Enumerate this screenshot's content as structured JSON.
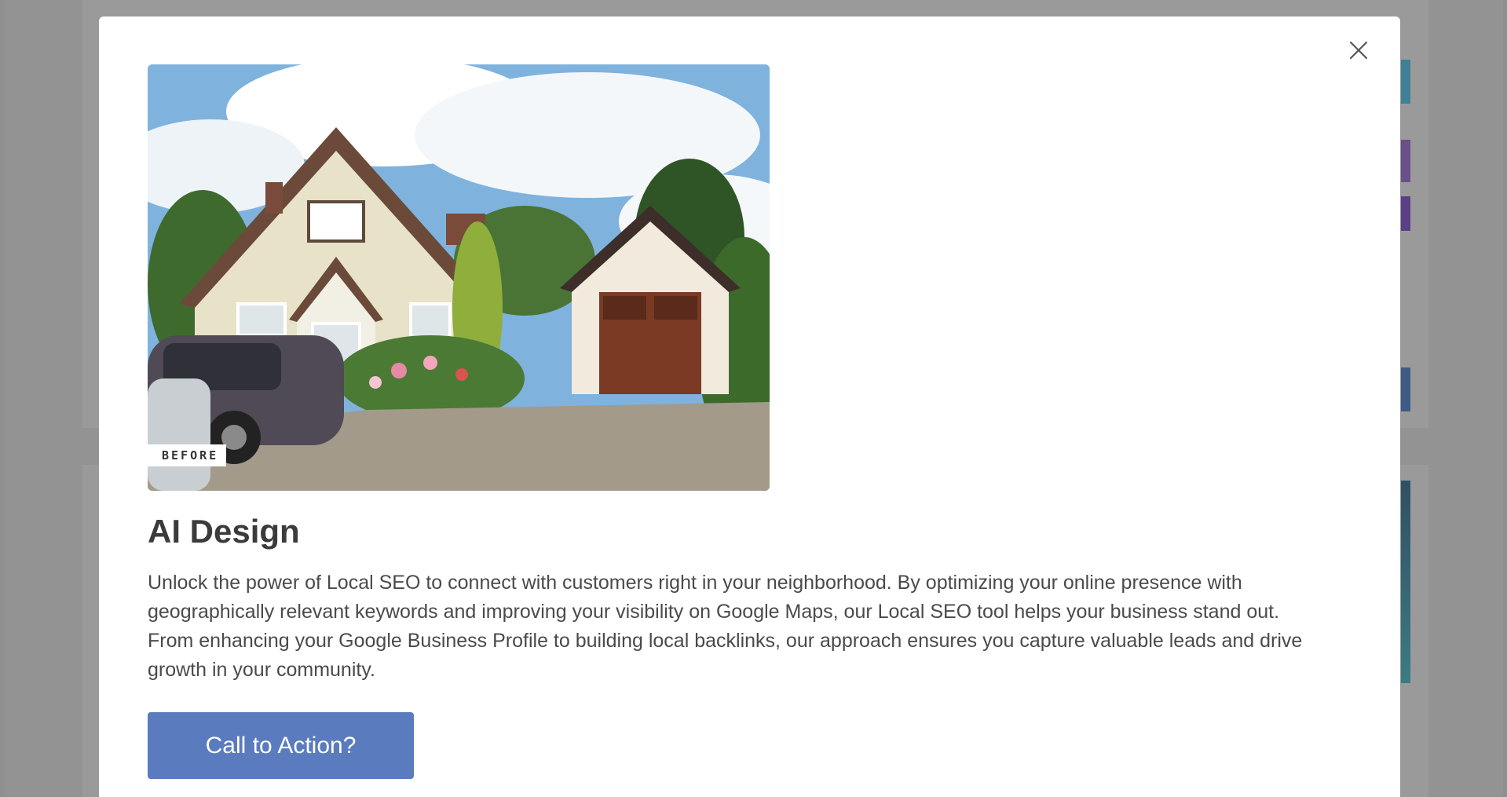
{
  "modal": {
    "image_badge": "BEFORE",
    "title": "AI Design",
    "description": "Unlock the power of Local SEO to connect with customers right in your neighborhood. By optimizing your online presence with geographically relevant keywords and improving your visibility on Google Maps, our Local SEO tool helps your business stand out. From enhancing your Google Business Profile to building local backlinks, our approach ensures you capture valuable leads and drive growth in your community.",
    "cta_label": "Call to Action?",
    "close_icon": "close-icon",
    "image_subject": "house-exterior-photo"
  },
  "colors": {
    "overlay": "#8f8f8f",
    "cta_background": "#5a7bbd",
    "title_text": "#3b3b3b",
    "body_text": "#4a4a4a"
  }
}
